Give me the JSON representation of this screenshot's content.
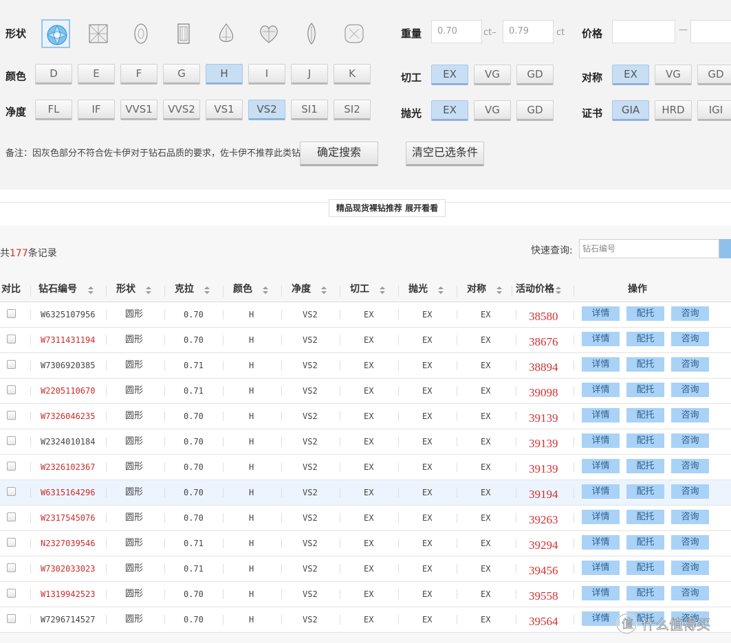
{
  "filters": {
    "shape_label": "形状",
    "shapes": [
      {
        "icon": "round-diamond-icon",
        "selected": true
      },
      {
        "icon": "princess-diamond-icon",
        "selected": false
      },
      {
        "icon": "oval-diamond-icon",
        "selected": false
      },
      {
        "icon": "emerald-diamond-icon",
        "selected": false
      },
      {
        "icon": "pear-diamond-icon",
        "selected": false
      },
      {
        "icon": "heart-diamond-icon",
        "selected": false
      },
      {
        "icon": "marquise-diamond-icon",
        "selected": false
      },
      {
        "icon": "cushion-diamond-icon",
        "selected": false
      }
    ],
    "color_label": "颜色",
    "colors": [
      {
        "label": "D",
        "selected": false
      },
      {
        "label": "E",
        "selected": false
      },
      {
        "label": "F",
        "selected": false
      },
      {
        "label": "G",
        "selected": false
      },
      {
        "label": "H",
        "selected": true
      },
      {
        "label": "I",
        "selected": false
      },
      {
        "label": "J",
        "selected": false
      },
      {
        "label": "K",
        "selected": false
      }
    ],
    "clarity_label": "净度",
    "clarities": [
      {
        "label": "FL",
        "selected": false
      },
      {
        "label": "IF",
        "selected": false
      },
      {
        "label": "VVS1",
        "selected": false
      },
      {
        "label": "VVS2",
        "selected": false
      },
      {
        "label": "VS1",
        "selected": false
      },
      {
        "label": "VS2",
        "selected": true
      },
      {
        "label": "SI1",
        "selected": false
      },
      {
        "label": "SI2",
        "selected": false
      }
    ],
    "weight_label": "重量",
    "weight_min": "0.70",
    "weight_max": "0.79",
    "weight_unit_mid": "ct–",
    "weight_unit": "ct",
    "price_label": "价格",
    "price_dash": "—",
    "cut_label": "切工",
    "cuts": [
      {
        "label": "EX",
        "selected": true
      },
      {
        "label": "VG",
        "selected": false
      },
      {
        "label": "GD",
        "selected": false
      }
    ],
    "symmetry_label": "对称",
    "symmetries": [
      {
        "label": "EX",
        "selected": true
      },
      {
        "label": "VG",
        "selected": false
      },
      {
        "label": "GD",
        "selected": false
      }
    ],
    "polish_label": "抛光",
    "polishes": [
      {
        "label": "EX",
        "selected": true
      },
      {
        "label": "VG",
        "selected": false
      },
      {
        "label": "GD",
        "selected": false
      }
    ],
    "cert_label": "证书",
    "certs": [
      {
        "label": "GIA",
        "selected": true
      },
      {
        "label": "HRD",
        "selected": false
      },
      {
        "label": "IGI",
        "selected": false
      }
    ],
    "note": "备注：因灰色部分不符合佐卡伊对于钻石品质的要求，佐卡伊不推荐此类钻石",
    "search_button": "确定搜索",
    "clear_button": "清空已选条件"
  },
  "recommend_tab": "精品现货裸钻推荐 展开看看",
  "list": {
    "count_prefix": "共",
    "count": "177",
    "count_suffix": "条记录",
    "quick_label": "快速查询:",
    "quick_placeholder": "钻石编号",
    "columns": [
      "对比",
      "钻石编号",
      "形状",
      "克拉",
      "颜色",
      "净度",
      "切工",
      "抛光",
      "对称",
      "活动价格",
      "操作"
    ],
    "actions": [
      "详情",
      "配托",
      "咨询"
    ],
    "rows": [
      {
        "id": "W6325107956",
        "red": false,
        "shape": "圆形",
        "carat": "0.70",
        "color": "H",
        "clarity": "VS2",
        "cut": "EX",
        "polish": "EX",
        "symmetry": "EX",
        "price": "38580"
      },
      {
        "id": "W7311431194",
        "red": true,
        "shape": "圆形",
        "carat": "0.70",
        "color": "H",
        "clarity": "VS2",
        "cut": "EX",
        "polish": "EX",
        "symmetry": "EX",
        "price": "38676"
      },
      {
        "id": "W7306920385",
        "red": false,
        "shape": "圆形",
        "carat": "0.71",
        "color": "H",
        "clarity": "VS2",
        "cut": "EX",
        "polish": "EX",
        "symmetry": "EX",
        "price": "38894"
      },
      {
        "id": "W2205110670",
        "red": true,
        "shape": "圆形",
        "carat": "0.71",
        "color": "H",
        "clarity": "VS2",
        "cut": "EX",
        "polish": "EX",
        "symmetry": "EX",
        "price": "39098"
      },
      {
        "id": "W7326046235",
        "red": true,
        "shape": "圆形",
        "carat": "0.70",
        "color": "H",
        "clarity": "VS2",
        "cut": "EX",
        "polish": "EX",
        "symmetry": "EX",
        "price": "39139"
      },
      {
        "id": "W2324010184",
        "red": false,
        "shape": "圆形",
        "carat": "0.70",
        "color": "H",
        "clarity": "VS2",
        "cut": "EX",
        "polish": "EX",
        "symmetry": "EX",
        "price": "39139"
      },
      {
        "id": "W2326102367",
        "red": true,
        "shape": "圆形",
        "carat": "0.70",
        "color": "H",
        "clarity": "VS2",
        "cut": "EX",
        "polish": "EX",
        "symmetry": "EX",
        "price": "39139"
      },
      {
        "id": "W6315164296",
        "red": true,
        "shape": "圆形",
        "carat": "0.70",
        "color": "H",
        "clarity": "VS2",
        "cut": "EX",
        "polish": "EX",
        "symmetry": "EX",
        "price": "39194"
      },
      {
        "id": "W2317545076",
        "red": true,
        "shape": "圆形",
        "carat": "0.70",
        "color": "H",
        "clarity": "VS2",
        "cut": "EX",
        "polish": "EX",
        "symmetry": "EX",
        "price": "39263"
      },
      {
        "id": "N2327039546",
        "red": true,
        "shape": "圆形",
        "carat": "0.71",
        "color": "H",
        "clarity": "VS2",
        "cut": "EX",
        "polish": "EX",
        "symmetry": "EX",
        "price": "39294"
      },
      {
        "id": "W7302033023",
        "red": true,
        "shape": "圆形",
        "carat": "0.71",
        "color": "H",
        "clarity": "VS2",
        "cut": "EX",
        "polish": "EX",
        "symmetry": "EX",
        "price": "39456"
      },
      {
        "id": "W1319942523",
        "red": true,
        "shape": "圆形",
        "carat": "0.70",
        "color": "H",
        "clarity": "VS2",
        "cut": "EX",
        "polish": "EX",
        "symmetry": "EX",
        "price": "39558"
      },
      {
        "id": "W7296714527",
        "red": false,
        "shape": "圆形",
        "carat": "0.70",
        "color": "H",
        "clarity": "VS2",
        "cut": "EX",
        "polish": "EX",
        "symmetry": "EX",
        "price": "39564"
      }
    ],
    "highlight_row": 7
  },
  "watermark": "值 什么值得买"
}
